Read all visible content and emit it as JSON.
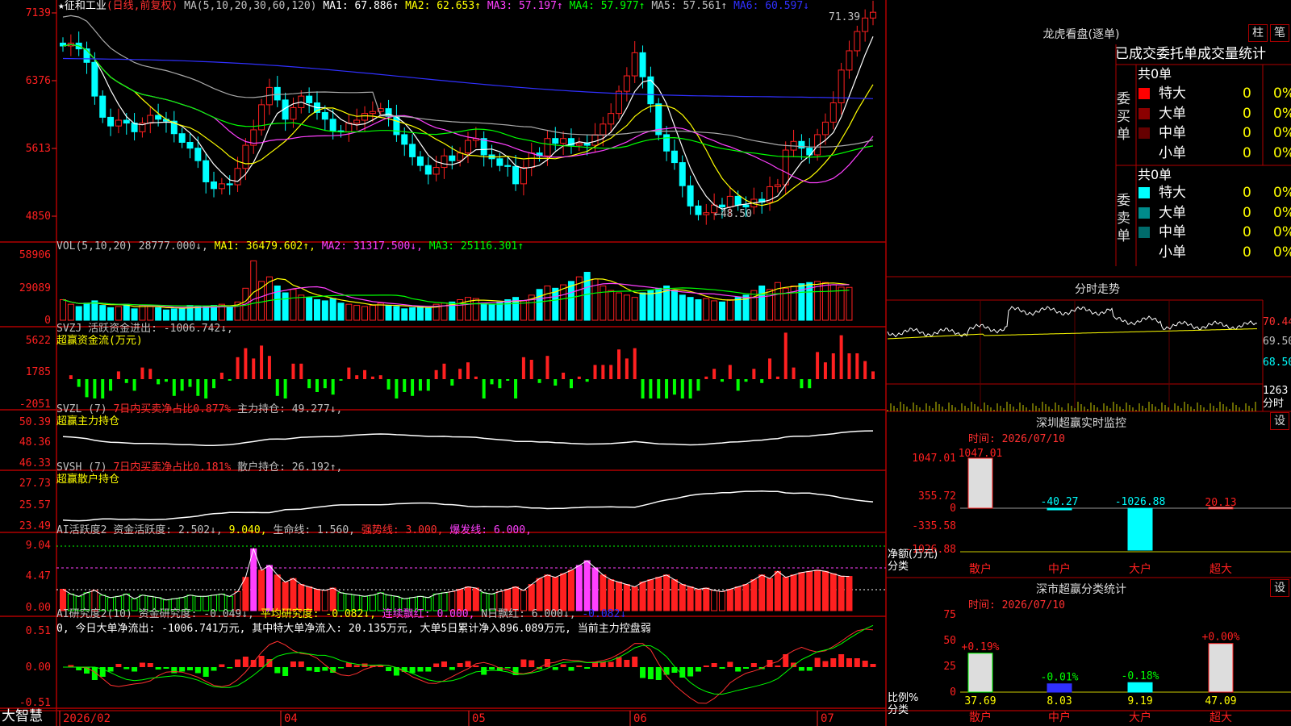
{
  "stock": {
    "name": "★征和工业",
    "mode": "(日线,前复权)"
  },
  "ma_line": [
    {
      "text": "MA(5,10,20,30,60,120)",
      "color": "#c0c0c0"
    },
    {
      "text": "MA1: 67.886↑",
      "color": "#ffffff"
    },
    {
      "text": "MA2: 62.653↑",
      "color": "#ffff00"
    },
    {
      "text": "MA3: 57.197↑",
      "color": "#ff40ff"
    },
    {
      "text": "MA4: 57.977↑",
      "color": "#00ff00"
    },
    {
      "text": "MA5: 57.561↑",
      "color": "#c0c0c0"
    },
    {
      "text": "MA6: 60.597↓",
      "color": "#3030ff"
    }
  ],
  "price_axis": [
    "7139",
    "6376",
    "5613",
    "4850"
  ],
  "high_mark": "71.39",
  "low_mark": "←48.50",
  "vol_line": [
    {
      "text": "VOL(5,10,20) 28777.000↓,",
      "color": "#c0c0c0"
    },
    {
      "text": "MA1: 36479.602↑,",
      "color": "#ffff00"
    },
    {
      "text": "MA2: 31317.500↓,",
      "color": "#ff40ff"
    },
    {
      "text": "MA3: 25116.301↑",
      "color": "#00ff00"
    }
  ],
  "vol_axis": [
    "58906",
    "29089",
    "0"
  ],
  "svzj": {
    "line1": "SVZJ  活跃资金进出: -1006.742↓,",
    "line2": "超赢资金流(万元)",
    "axis": [
      "5622",
      "1785",
      "-2051"
    ]
  },
  "svzl": {
    "prefix": "SVZL (7)",
    "red": "7日内买卖净占比0.877%",
    "rest": "主力持仓: 49.277↓,",
    "line2": "超赢主力持仓",
    "axis": [
      "50.39",
      "48.36",
      "46.33"
    ]
  },
  "svsh": {
    "prefix": "SVSH (7)",
    "red": "7日内买卖净占比0.181%",
    "rest": "散户持仓: 26.192↑,",
    "line2": "超赢散户持仓",
    "axis": [
      "27.73",
      "25.57",
      "23.49"
    ]
  },
  "ai1": {
    "parts": [
      {
        "text": "AI活跃度2 资金活跃度: 2.502↓,",
        "color": "#c0c0c0"
      },
      {
        "text": "9.040,",
        "color": "#ffff00"
      },
      {
        "text": "生命线: 1.560,",
        "color": "#c0c0c0"
      },
      {
        "text": "强势线: 3.000,",
        "color": "#ff3030"
      },
      {
        "text": "爆发线: 6.000,",
        "color": "#ff40ff"
      }
    ],
    "axis": [
      "9.04",
      "4.47",
      "0.00"
    ]
  },
  "ai2": {
    "parts": [
      {
        "text": "AI研究度2(10) 资金研究度: -0.049↓,",
        "color": "#c0c0c0"
      },
      {
        "text": "平均研究度: -0.082↓,",
        "color": "#ffff00"
      },
      {
        "text": "连续飘红: 0.000,",
        "color": "#ff40ff"
      },
      {
        "text": "N日飘红: 6.000↓,",
        "color": "#c0c0c0"
      },
      {
        "text": "-0.082↓",
        "color": "#3030ff"
      }
    ],
    "line2": "0, 今日大单净流出: -1006.741万元, 其中特大单净流入: 20.135万元, 大单5日累计净入896.089万元, 当前主力控盘弱",
    "axis": [
      "0.51",
      "0.00",
      "-0.51"
    ]
  },
  "date_axis": [
    "2026/02",
    "04",
    "05",
    "06",
    "07"
  ],
  "footer_brand": "大智慧",
  "right": {
    "dragon_title": "龙虎看盘(逐单)",
    "btn1": "柱",
    "btn2": "笔",
    "tabs": "已成交委托单成交量统计",
    "buy_label": "委买单",
    "sell_label": "委卖单",
    "buy_total": "共0单",
    "sell_total": "共0单",
    "buy_rows": [
      {
        "n": "特大",
        "v": "0",
        "p": "0%",
        "c": "#ff0000"
      },
      {
        "n": "大单",
        "v": "0",
        "p": "0%",
        "c": "#8b0000"
      },
      {
        "n": "中单",
        "v": "0",
        "p": "0%",
        "c": "#660000"
      },
      {
        "n": "小单",
        "v": "0",
        "p": "0%",
        "c": ""
      }
    ],
    "sell_rows": [
      {
        "n": "特大",
        "v": "0",
        "p": "0%",
        "c": "#00ffff"
      },
      {
        "n": "大单",
        "v": "0",
        "p": "0%",
        "c": "#008b8b"
      },
      {
        "n": "中单",
        "v": "0",
        "p": "0%",
        "c": "#006b6b"
      },
      {
        "n": "小单",
        "v": "0",
        "p": "0%",
        "c": ""
      }
    ],
    "intraday_title": "分时走势",
    "intraday_axis": [
      "70.44",
      "69.50",
      "68.50"
    ],
    "intraday_vol": "1263",
    "intraday_vol_unit": "分时",
    "monitor_title": "深圳超赢实时监控",
    "set": "设",
    "monitor_time": "时间: 2026/07/10",
    "monitor_axis": [
      "1047.01",
      "355.72",
      "0",
      "-335.58",
      "-1026.88"
    ],
    "monitor_unit1": "净额(万元)",
    "monitor_unit2": "分类",
    "monitor_bars": [
      {
        "cat": "散户",
        "value": 1047.01,
        "label": "1047.01"
      },
      {
        "cat": "中户",
        "value": -40.27,
        "label": "-40.27"
      },
      {
        "cat": "大户",
        "value": -1026.88,
        "label": "-1026.88"
      },
      {
        "cat": "超大",
        "value": 20.13,
        "label": "20.13"
      }
    ],
    "class_title": "深市超赢分类统计",
    "class_time": "时间: 2026/07/10",
    "class_axis": [
      "75",
      "50",
      "25",
      "0"
    ],
    "class_unit1": "比例%",
    "class_unit2": "分类",
    "class_bars": [
      {
        "cat": "散户",
        "value": 37.69,
        "label": "37.69",
        "chg": "+0.19%"
      },
      {
        "cat": "中户",
        "value": 8.03,
        "label": "8.03",
        "chg": "-0.01%"
      },
      {
        "cat": "大户",
        "value": 9.19,
        "label": "9.19",
        "chg": "-0.18%"
      },
      {
        "cat": "超大",
        "value": 47.09,
        "label": "47.09",
        "chg": "+0.00%"
      }
    ]
  },
  "chart_data": {
    "type": "candlestick",
    "title": "征和工业 日线 前复权",
    "ylim": [
      48.5,
      71.39
    ],
    "categories_months": [
      "2026/02",
      "04",
      "05",
      "06",
      "07"
    ],
    "close": [
      67.5,
      67.8,
      67.2,
      65.8,
      62.3,
      60.1,
      59.2,
      59.8,
      59.5,
      58.6,
      59.5,
      60.3,
      59.9,
      59.7,
      58.4,
      57.5,
      56.9,
      55.6,
      53.4,
      52.7,
      53.2,
      53.1,
      54.8,
      57.2,
      58.8,
      61.4,
      63.2,
      61.9,
      59.9,
      61.1,
      62.3,
      61.6,
      60.6,
      59.9,
      58.7,
      58.6,
      59.5,
      59.8,
      60.5,
      60.7,
      61.0,
      60.2,
      58.3,
      57.3,
      56.0,
      55.1,
      54.2,
      54.9,
      56.1,
      55.6,
      56.4,
      57.7,
      57.9,
      56.2,
      55.8,
      55.1,
      55.0,
      53.2,
      54.9,
      56.4,
      56.1,
      57.9,
      57.4,
      57.9,
      57.2,
      57.4,
      57.2,
      58.3,
      59.4,
      60.5,
      62.8,
      64.4,
      66.8,
      64.3,
      61.5,
      58.3,
      56.6,
      55.4,
      53.0,
      50.9,
      50.0,
      50.2,
      51.0,
      50.8,
      51.9,
      51.0,
      50.8,
      51.6,
      51.3,
      52.9,
      53.1,
      56.7,
      57.6,
      56.9,
      56.2,
      58.3,
      59.6,
      61.6,
      65.0,
      67.0,
      69.0,
      70.4,
      71.0
    ],
    "volume": [
      18000,
      14000,
      12000,
      15000,
      17000,
      13000,
      11000,
      12000,
      14000,
      10000,
      13000,
      12000,
      11000,
      9000,
      10000,
      11000,
      13000,
      12000,
      12000,
      13000,
      14000,
      12000,
      16000,
      28000,
      52000,
      34000,
      38000,
      30000,
      24000,
      27000,
      22000,
      20000,
      18000,
      17000,
      19000,
      15000,
      14000,
      13000,
      12000,
      13000,
      15000,
      13000,
      12000,
      10000,
      11000,
      12000,
      11000,
      14000,
      15000,
      16000,
      18000,
      20000,
      19000,
      15000,
      14000,
      16000,
      18000,
      20000,
      17000,
      22000,
      27000,
      30000,
      28000,
      31000,
      34000,
      38000,
      42000,
      36000,
      30000,
      26000,
      24000,
      22000,
      20000,
      24000,
      26000,
      28000,
      30000,
      26000,
      22000,
      20000,
      18000,
      19000,
      17000,
      16000,
      18000,
      20000,
      22000,
      26000,
      30000,
      27000,
      33000,
      28000,
      30000,
      32000,
      33000,
      34000,
      33000,
      31000,
      29000,
      28777
    ],
    "bars_count": 95
  }
}
